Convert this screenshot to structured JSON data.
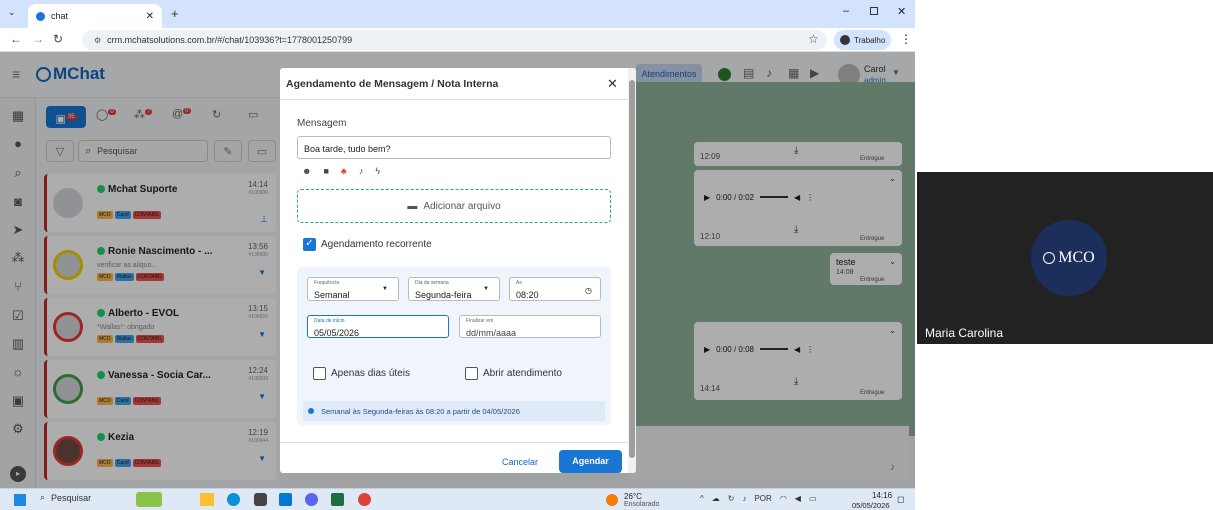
{
  "browser": {
    "tab_title": "chat",
    "url": "crm.mchatsolutions.com.br/#/chat/103936?t=1778001250799",
    "profile": "Trabalho"
  },
  "app": {
    "logo": "MChat",
    "status_button": "Atendimentos",
    "user_name": "Carol",
    "user_role": "admin",
    "search_placeholder": "Pesquisar",
    "badges": {
      "chats": "35",
      "waiting": "0",
      "groups": "7",
      "mentions": "0"
    },
    "chats": [
      {
        "name": "Mchat Suporte",
        "time": "14:14",
        "id": "#100936",
        "preview": "",
        "tags": [
          "MCO",
          "Carol",
          "CONTABIL"
        ]
      },
      {
        "name": "Ronie Nascimento - ...",
        "time": "13:56",
        "id": "#136500",
        "preview": "verificar as aliquo...",
        "tags": [
          "MCO",
          "Wallas",
          "CONTABIL"
        ]
      },
      {
        "name": "Alberto - EVOL",
        "time": "13:15",
        "id": "#106555",
        "preview": "*Wallas*: obrigado",
        "tags": [
          "MCO",
          "Wallas",
          "CONTABIL"
        ]
      },
      {
        "name": "Vanessa - Socia Car...",
        "time": "12:24",
        "id": "#100939",
        "preview": "",
        "tags": [
          "MCO",
          "Carol",
          "CONTABIL"
        ]
      },
      {
        "name": "Kezia",
        "time": "12:19",
        "id": "#100944",
        "preview": "",
        "tags": [
          "MCO",
          "Carol",
          "CONTABIL"
        ]
      }
    ],
    "messages": {
      "msg1_time": "12:09",
      "msg1_status": "Entregue",
      "audio1": "0:00 / 0:02",
      "msg2_time": "12:10",
      "msg2_status": "Entregue",
      "text_msg": "teste",
      "text_time": "14:08",
      "text_status": "Entregue",
      "audio2": "0:00 / 0:08",
      "msg3_time": "14:14",
      "msg3_status": "Entregue"
    }
  },
  "modal": {
    "title": "Agendamento de Mensagem / Nota Interna",
    "message_label": "Mensagem",
    "message_value": "Boa tarde, tudo bem?",
    "attach_label": "Adicionar arquivo",
    "recurring_label": "Agendamento recorrente",
    "recurring_checked": true,
    "frequency_label": "Frequência",
    "frequency_value": "Semanal",
    "weekday_label": "Dia da semana",
    "weekday_value": "Segunda-feira",
    "time_label": "Às",
    "time_value": "08:20",
    "start_label": "Data de início",
    "start_value": "05/05/2026",
    "end_label": "Finalizar em",
    "end_placeholder": "dd/mm/aaaa",
    "business_days_label": "Apenas dias úteis",
    "open_ticket_label": "Abrir atendimento",
    "summary": "Semanal às Segunda-feiras às 08:20 a partir de 04/05/2026",
    "cancel_label": "Cancelar",
    "submit_label": "Agendar"
  },
  "taskbar": {
    "search": "Pesquisar",
    "temp": "26°C",
    "weather": "Ensolarado",
    "lang": "POR",
    "time": "14:16",
    "date": "05/05/2026"
  },
  "video": {
    "participant": "Maria Carolina",
    "logo_text": "MCO"
  },
  "colors": {
    "accent": "#1976d2",
    "teal": "#00897b",
    "chat_bg": "#8fb39b",
    "red": "#e53935"
  }
}
